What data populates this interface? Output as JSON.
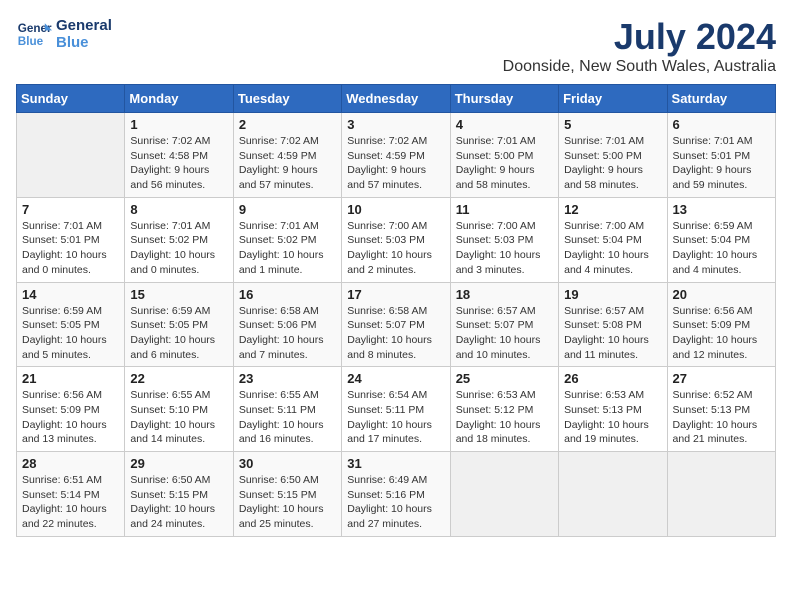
{
  "header": {
    "logo_line1": "General",
    "logo_line2": "Blue",
    "month": "July 2024",
    "location": "Doonside, New South Wales, Australia"
  },
  "days_of_week": [
    "Sunday",
    "Monday",
    "Tuesday",
    "Wednesday",
    "Thursday",
    "Friday",
    "Saturday"
  ],
  "weeks": [
    [
      {
        "day": "",
        "sunrise": "",
        "sunset": "",
        "daylight": ""
      },
      {
        "day": "1",
        "sunrise": "7:02 AM",
        "sunset": "4:58 PM",
        "daylight": "9 hours and 56 minutes."
      },
      {
        "day": "2",
        "sunrise": "7:02 AM",
        "sunset": "4:59 PM",
        "daylight": "9 hours and 57 minutes."
      },
      {
        "day": "3",
        "sunrise": "7:02 AM",
        "sunset": "4:59 PM",
        "daylight": "9 hours and 57 minutes."
      },
      {
        "day": "4",
        "sunrise": "7:01 AM",
        "sunset": "5:00 PM",
        "daylight": "9 hours and 58 minutes."
      },
      {
        "day": "5",
        "sunrise": "7:01 AM",
        "sunset": "5:00 PM",
        "daylight": "9 hours and 58 minutes."
      },
      {
        "day": "6",
        "sunrise": "7:01 AM",
        "sunset": "5:01 PM",
        "daylight": "9 hours and 59 minutes."
      }
    ],
    [
      {
        "day": "7",
        "sunrise": "7:01 AM",
        "sunset": "5:01 PM",
        "daylight": "10 hours and 0 minutes."
      },
      {
        "day": "8",
        "sunrise": "7:01 AM",
        "sunset": "5:02 PM",
        "daylight": "10 hours and 0 minutes."
      },
      {
        "day": "9",
        "sunrise": "7:01 AM",
        "sunset": "5:02 PM",
        "daylight": "10 hours and 1 minute."
      },
      {
        "day": "10",
        "sunrise": "7:00 AM",
        "sunset": "5:03 PM",
        "daylight": "10 hours and 2 minutes."
      },
      {
        "day": "11",
        "sunrise": "7:00 AM",
        "sunset": "5:03 PM",
        "daylight": "10 hours and 3 minutes."
      },
      {
        "day": "12",
        "sunrise": "7:00 AM",
        "sunset": "5:04 PM",
        "daylight": "10 hours and 4 minutes."
      },
      {
        "day": "13",
        "sunrise": "6:59 AM",
        "sunset": "5:04 PM",
        "daylight": "10 hours and 4 minutes."
      }
    ],
    [
      {
        "day": "14",
        "sunrise": "6:59 AM",
        "sunset": "5:05 PM",
        "daylight": "10 hours and 5 minutes."
      },
      {
        "day": "15",
        "sunrise": "6:59 AM",
        "sunset": "5:05 PM",
        "daylight": "10 hours and 6 minutes."
      },
      {
        "day": "16",
        "sunrise": "6:58 AM",
        "sunset": "5:06 PM",
        "daylight": "10 hours and 7 minutes."
      },
      {
        "day": "17",
        "sunrise": "6:58 AM",
        "sunset": "5:07 PM",
        "daylight": "10 hours and 8 minutes."
      },
      {
        "day": "18",
        "sunrise": "6:57 AM",
        "sunset": "5:07 PM",
        "daylight": "10 hours and 10 minutes."
      },
      {
        "day": "19",
        "sunrise": "6:57 AM",
        "sunset": "5:08 PM",
        "daylight": "10 hours and 11 minutes."
      },
      {
        "day": "20",
        "sunrise": "6:56 AM",
        "sunset": "5:09 PM",
        "daylight": "10 hours and 12 minutes."
      }
    ],
    [
      {
        "day": "21",
        "sunrise": "6:56 AM",
        "sunset": "5:09 PM",
        "daylight": "10 hours and 13 minutes."
      },
      {
        "day": "22",
        "sunrise": "6:55 AM",
        "sunset": "5:10 PM",
        "daylight": "10 hours and 14 minutes."
      },
      {
        "day": "23",
        "sunrise": "6:55 AM",
        "sunset": "5:11 PM",
        "daylight": "10 hours and 16 minutes."
      },
      {
        "day": "24",
        "sunrise": "6:54 AM",
        "sunset": "5:11 PM",
        "daylight": "10 hours and 17 minutes."
      },
      {
        "day": "25",
        "sunrise": "6:53 AM",
        "sunset": "5:12 PM",
        "daylight": "10 hours and 18 minutes."
      },
      {
        "day": "26",
        "sunrise": "6:53 AM",
        "sunset": "5:13 PM",
        "daylight": "10 hours and 19 minutes."
      },
      {
        "day": "27",
        "sunrise": "6:52 AM",
        "sunset": "5:13 PM",
        "daylight": "10 hours and 21 minutes."
      }
    ],
    [
      {
        "day": "28",
        "sunrise": "6:51 AM",
        "sunset": "5:14 PM",
        "daylight": "10 hours and 22 minutes."
      },
      {
        "day": "29",
        "sunrise": "6:50 AM",
        "sunset": "5:15 PM",
        "daylight": "10 hours and 24 minutes."
      },
      {
        "day": "30",
        "sunrise": "6:50 AM",
        "sunset": "5:15 PM",
        "daylight": "10 hours and 25 minutes."
      },
      {
        "day": "31",
        "sunrise": "6:49 AM",
        "sunset": "5:16 PM",
        "daylight": "10 hours and 27 minutes."
      },
      {
        "day": "",
        "sunrise": "",
        "sunset": "",
        "daylight": ""
      },
      {
        "day": "",
        "sunrise": "",
        "sunset": "",
        "daylight": ""
      },
      {
        "day": "",
        "sunrise": "",
        "sunset": "",
        "daylight": ""
      }
    ]
  ]
}
